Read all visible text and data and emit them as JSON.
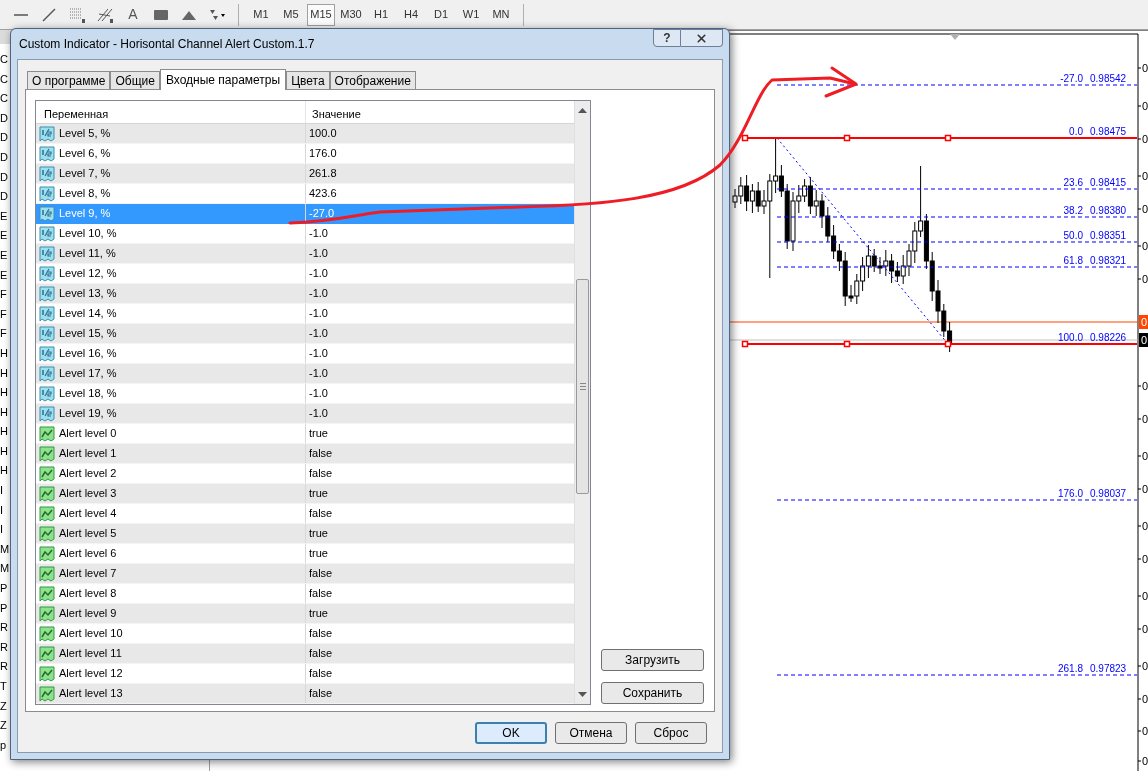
{
  "toolbar": {
    "text_tool": "A",
    "timeframes": [
      {
        "label": "M1",
        "selected": false
      },
      {
        "label": "M5",
        "selected": false
      },
      {
        "label": "M15",
        "selected": true
      },
      {
        "label": "M30",
        "selected": false
      },
      {
        "label": "H1",
        "selected": false
      },
      {
        "label": "H4",
        "selected": false
      },
      {
        "label": "D1",
        "selected": false
      },
      {
        "label": "W1",
        "selected": false
      },
      {
        "label": "MN",
        "selected": false
      }
    ]
  },
  "navigator": {
    "items": [
      "C",
      "C",
      "C",
      "D",
      "D",
      "D",
      "D",
      "D",
      "E",
      "E",
      "E",
      "E",
      "F",
      "F",
      "F",
      "H",
      "H",
      "H",
      "H",
      "H",
      "H",
      "H",
      "I",
      "I",
      "I",
      "M",
      "M",
      "P",
      "P",
      "R",
      "R",
      "R",
      "T",
      "Z",
      "Z",
      "p"
    ]
  },
  "dialog": {
    "title": "Custom Indicator - Horisontal Channel Alert Custom.1.7",
    "help": "?",
    "tabs": [
      {
        "label": "О программе",
        "selected": false
      },
      {
        "label": "Общие",
        "selected": false
      },
      {
        "label": "Входные параметры",
        "selected": true
      },
      {
        "label": "Цвета",
        "selected": false
      },
      {
        "label": "Отображение",
        "selected": false
      }
    ],
    "table": {
      "columns": [
        "Переменная",
        "Значение"
      ],
      "rows": [
        {
          "kind": "double",
          "name": "Level 5, %",
          "value": "100.0",
          "selected": false
        },
        {
          "kind": "double",
          "name": "Level 6, %",
          "value": "176.0",
          "selected": false
        },
        {
          "kind": "double",
          "name": "Level 7, %",
          "value": "261.8",
          "selected": false
        },
        {
          "kind": "double",
          "name": "Level 8, %",
          "value": "423.6",
          "selected": false
        },
        {
          "kind": "double",
          "name": "Level 9, %",
          "value": "-27.0",
          "selected": true
        },
        {
          "kind": "double",
          "name": "Level 10, %",
          "value": "-1.0",
          "selected": false
        },
        {
          "kind": "double",
          "name": "Level 11, %",
          "value": "-1.0",
          "selected": false
        },
        {
          "kind": "double",
          "name": "Level 12, %",
          "value": "-1.0",
          "selected": false
        },
        {
          "kind": "double",
          "name": "Level 13, %",
          "value": "-1.0",
          "selected": false
        },
        {
          "kind": "double",
          "name": "Level 14, %",
          "value": "-1.0",
          "selected": false
        },
        {
          "kind": "double",
          "name": "Level 15, %",
          "value": "-1.0",
          "selected": false
        },
        {
          "kind": "double",
          "name": "Level 16, %",
          "value": "-1.0",
          "selected": false
        },
        {
          "kind": "double",
          "name": "Level 17, %",
          "value": "-1.0",
          "selected": false
        },
        {
          "kind": "double",
          "name": "Level 18, %",
          "value": "-1.0",
          "selected": false
        },
        {
          "kind": "double",
          "name": "Level 19, %",
          "value": "-1.0",
          "selected": false
        },
        {
          "kind": "bool",
          "name": "Alert level 0",
          "value": "true",
          "selected": false
        },
        {
          "kind": "bool",
          "name": "Alert level 1",
          "value": "false",
          "selected": false
        },
        {
          "kind": "bool",
          "name": "Alert level 2",
          "value": "false",
          "selected": false
        },
        {
          "kind": "bool",
          "name": "Alert level 3",
          "value": "true",
          "selected": false
        },
        {
          "kind": "bool",
          "name": "Alert level 4",
          "value": "false",
          "selected": false
        },
        {
          "kind": "bool",
          "name": "Alert level 5",
          "value": "true",
          "selected": false
        },
        {
          "kind": "bool",
          "name": "Alert level 6",
          "value": "true",
          "selected": false
        },
        {
          "kind": "bool",
          "name": "Alert level 7",
          "value": "false",
          "selected": false
        },
        {
          "kind": "bool",
          "name": "Alert level 8",
          "value": "false",
          "selected": false
        },
        {
          "kind": "bool",
          "name": "Alert level 9",
          "value": "true",
          "selected": false
        },
        {
          "kind": "bool",
          "name": "Alert level 10",
          "value": "false",
          "selected": false
        },
        {
          "kind": "bool",
          "name": "Alert level 11",
          "value": "false",
          "selected": false
        },
        {
          "kind": "bool",
          "name": "Alert level 12",
          "value": "false",
          "selected": false
        },
        {
          "kind": "bool",
          "name": "Alert level 13",
          "value": "false",
          "selected": false
        }
      ]
    },
    "side_buttons": [
      "Загрузить",
      "Сохранить"
    ],
    "buttons": [
      {
        "label": "OK",
        "default": true
      },
      {
        "label": "Отмена",
        "default": false
      },
      {
        "label": "Сброс",
        "default": false
      }
    ]
  },
  "chart": {
    "levels": [
      {
        "label": "-27.0",
        "price": "0.98542"
      },
      {
        "label": "0.0",
        "price": "0.98475"
      },
      {
        "label": "23.6",
        "price": "0.98415"
      },
      {
        "label": "38.2",
        "price": "0.98380"
      },
      {
        "label": "50.0",
        "price": "0.98351"
      },
      {
        "label": "61.8",
        "price": "0.98321"
      },
      {
        "label": "100.0",
        "price": "0.98226"
      },
      {
        "label": "176.0",
        "price": "0.98037"
      },
      {
        "label": "261.8",
        "price": "0.97823"
      }
    ],
    "axis_labels": [
      "0",
      "0",
      "0",
      "0",
      "0",
      "0",
      "0",
      "0",
      "0",
      "0",
      "0",
      "0",
      "0",
      "0",
      "0",
      "0",
      "0",
      "0",
      "0"
    ],
    "price_tags": [
      {
        "text": "0",
        "color": "#ff4500"
      },
      {
        "text": "0",
        "color": "#000000"
      }
    ]
  }
}
